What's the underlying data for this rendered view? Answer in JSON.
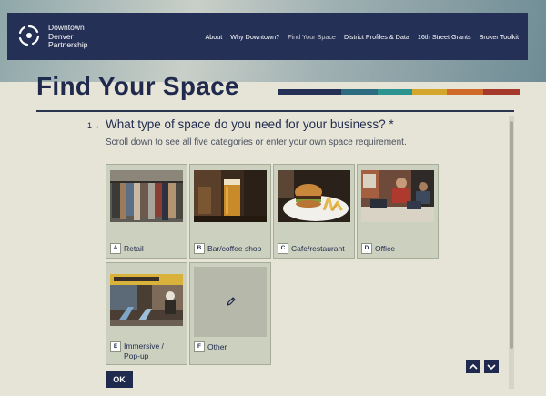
{
  "header": {
    "brand_lines": [
      "Downtown",
      "Denver",
      "Partnership"
    ],
    "nav": [
      {
        "label": "About",
        "active": false
      },
      {
        "label": "Why Downtown?",
        "active": false
      },
      {
        "label": "Find Your Space",
        "active": true
      },
      {
        "label": "District Profiles & Data",
        "active": false
      },
      {
        "label": "16th Street Grants",
        "active": false
      },
      {
        "label": "Broker Toolkit",
        "active": false
      }
    ]
  },
  "page": {
    "title": "Find Your Space",
    "stripe_colors": [
      "#253057",
      "#2d6b80",
      "#2b9490",
      "#d4a72c",
      "#cf6a2a",
      "#a63a2a"
    ]
  },
  "question": {
    "number": "1",
    "text": "What type of space do you need for your business? *",
    "subtext": "Scroll down to see all five categories or enter your own space requirement."
  },
  "options": [
    {
      "key": "A",
      "label": "Retail",
      "image": "clothing-rack-photo"
    },
    {
      "key": "B",
      "label": "Bar/coffee shop",
      "image": "beer-glass-photo"
    },
    {
      "key": "C",
      "label": "Cafe/restaurant",
      "image": "burger-fries-photo"
    },
    {
      "key": "D",
      "label": "Office",
      "image": "office-workers-photo"
    },
    {
      "key": "E",
      "label": "Immersive / Pop-up",
      "image": "popup-lounge-photo"
    },
    {
      "key": "F",
      "label": "Other",
      "image": "pencil-icon"
    }
  ],
  "controls": {
    "ok_label": "OK",
    "up_icon": "chevron-up-icon",
    "down_icon": "chevron-down-icon"
  }
}
